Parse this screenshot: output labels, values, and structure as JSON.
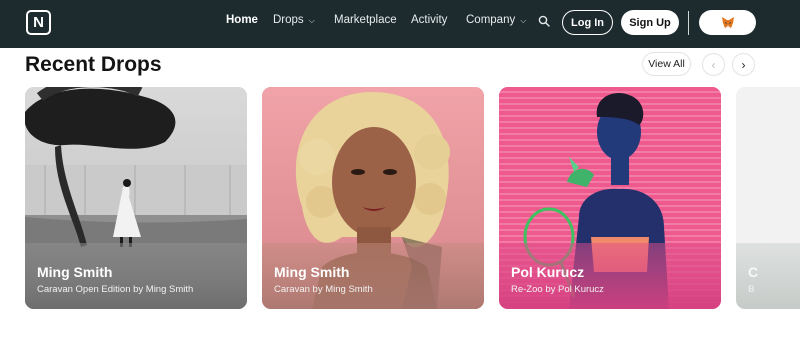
{
  "nav": {
    "logo_letter": "N",
    "items": [
      {
        "label": "Home",
        "active": true,
        "has_dropdown": false
      },
      {
        "label": "Drops",
        "active": false,
        "has_dropdown": true
      },
      {
        "label": "Marketplace",
        "active": false,
        "has_dropdown": false
      },
      {
        "label": "Activity",
        "active": false,
        "has_dropdown": false
      },
      {
        "label": "Company",
        "active": false,
        "has_dropdown": true
      }
    ],
    "search_icon": "search-icon",
    "login_label": "Log In",
    "signup_label": "Sign Up",
    "wallet_icon": "metamask-fox-icon",
    "colors": {
      "background": "#1d2b2e",
      "text": "#ffffff"
    }
  },
  "section": {
    "title": "Recent Drops",
    "view_all_label": "View All",
    "prev_icon": "chevron-left-icon",
    "next_icon": "chevron-right-icon"
  },
  "cards": [
    {
      "title": "Ming Smith",
      "subtitle": "Caravan Open Edition by Ming Smith",
      "image": "black-and-white photo of a dancer beside a wind-bent tree"
    },
    {
      "title": "Ming Smith",
      "subtitle": "Caravan by Ming Smith",
      "image": "portrait of a woman with blonde curled hair"
    },
    {
      "title": "Pol Kurucz",
      "subtitle": "Re-Zoo by Pol Kurucz",
      "image": "woman in blue with a green parrot against a pink blind"
    },
    {
      "title": "C",
      "subtitle": "B",
      "image": "partially visible card"
    }
  ]
}
